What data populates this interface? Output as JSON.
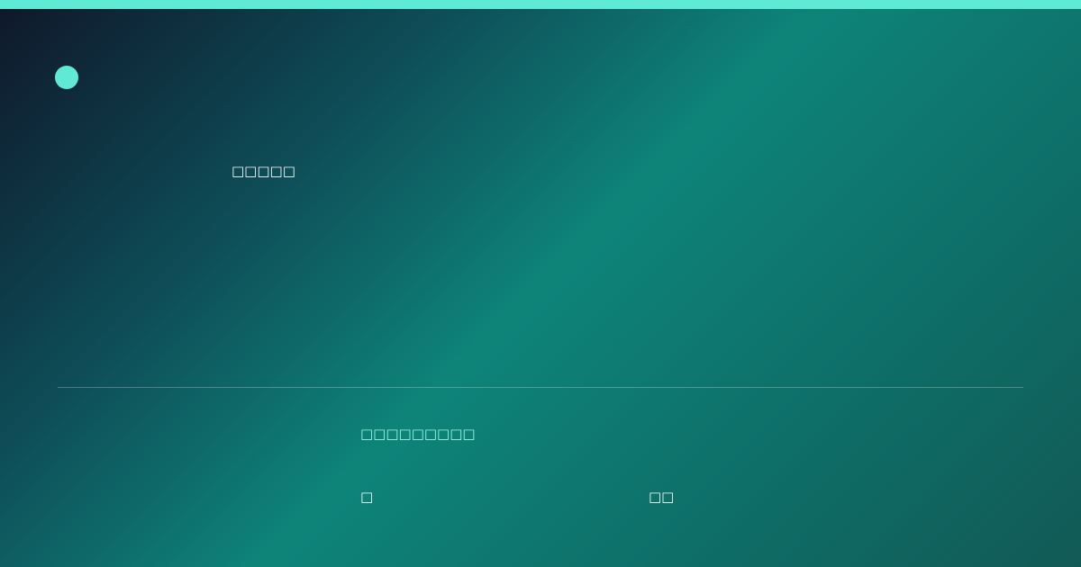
{
  "card": {
    "headline": "□□□□□",
    "subhead": "□□□□□□□□□",
    "meta_left": "□",
    "meta_right": "□□"
  },
  "colors": {
    "accent": "#5eead4",
    "subhead": "#99f6e4",
    "text": "#f8fafc",
    "gradient_start": "#0f172a",
    "gradient_mid": "#0e8479",
    "gradient_end": "#125a56"
  },
  "icons": {
    "brand": "logo-dot-icon"
  }
}
